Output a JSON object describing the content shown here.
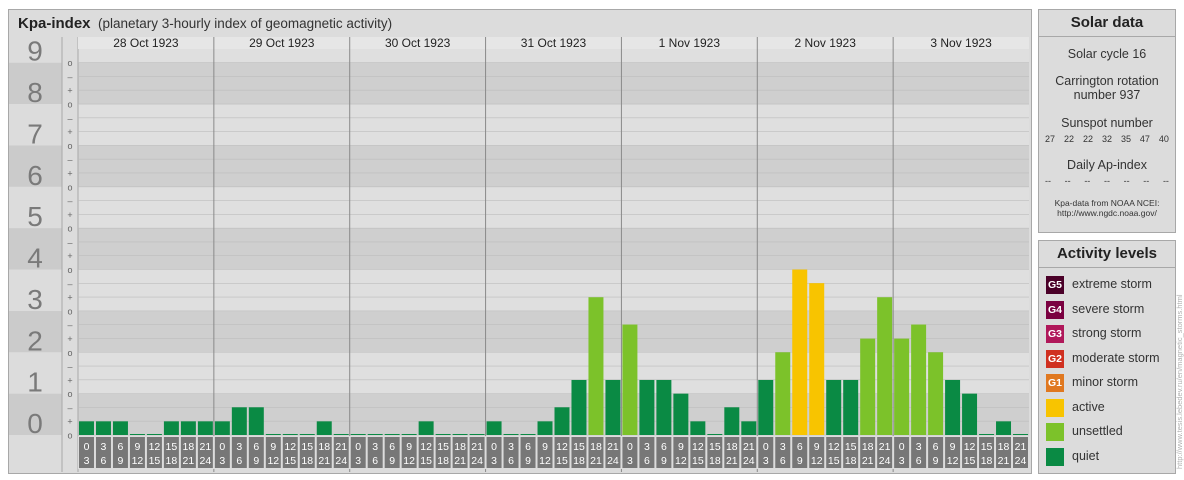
{
  "header": {
    "title": "Kpa-index",
    "subtitle": "(planetary 3-hourly index of geomagnetic activity)"
  },
  "chart_data": {
    "type": "bar",
    "days": [
      "28 Oct 1923",
      "29 Oct 1923",
      "30 Oct 1923",
      "31 Oct 1923",
      "1 Nov 1923",
      "2 Nov 1923",
      "3 Nov 1923"
    ],
    "interval_labels": [
      [
        "0",
        "3"
      ],
      [
        "3",
        "6"
      ],
      [
        "6",
        "9"
      ],
      [
        "9",
        "12"
      ],
      [
        "12",
        "15"
      ],
      [
        "15",
        "18"
      ],
      [
        "18",
        "21"
      ],
      [
        "21",
        "24"
      ]
    ],
    "y_major_labels": [
      "0",
      "1",
      "2",
      "3",
      "4",
      "5",
      "6",
      "7",
      "8",
      "9"
    ],
    "y_minor_labels": [
      "o",
      "+",
      "–",
      "o"
    ],
    "ylim": [
      0,
      9.33
    ],
    "values": [
      [
        0.33,
        0.33,
        0.33,
        0,
        0,
        0.33,
        0.33,
        0.33
      ],
      [
        0.33,
        0.67,
        0.67,
        0,
        0,
        0,
        0.33,
        0
      ],
      [
        0,
        0,
        0,
        0,
        0.33,
        0,
        0,
        0
      ],
      [
        0.33,
        0,
        0,
        0.33,
        0.67,
        1.33,
        3.33,
        1.33
      ],
      [
        2.67,
        1.33,
        1.33,
        1,
        0.33,
        0,
        0.67,
        0.33
      ],
      [
        1.33,
        2,
        4,
        3.67,
        1.33,
        1.33,
        2.33,
        3.33
      ],
      [
        2.33,
        2.67,
        2,
        1.33,
        1,
        0,
        0.33,
        0
      ]
    ],
    "grid": true
  },
  "solar": {
    "title": "Solar data",
    "cycle": "Solar cycle 16",
    "carrington_line1": "Carrington rotation",
    "carrington_line2": "number 937",
    "sunspot_title": "Sunspot number",
    "sunspots": [
      "27",
      "22",
      "22",
      "32",
      "35",
      "47",
      "40"
    ],
    "ap_title": "Daily Ap-index",
    "ap": [
      "--",
      "--",
      "--",
      "--",
      "--",
      "--",
      "--"
    ],
    "source_line1": "Kpa-data from NOAA NCEI:",
    "source_line2": "http://www.ngdc.noaa.gov/"
  },
  "activity": {
    "title": "Activity levels",
    "items": [
      {
        "badge": "G5",
        "label": "extreme storm",
        "color": "#4a0028"
      },
      {
        "badge": "G4",
        "label": "severe storm",
        "color": "#7a0040"
      },
      {
        "badge": "G3",
        "label": "strong storm",
        "color": "#b0185a"
      },
      {
        "badge": "G2",
        "label": "moderate storm",
        "color": "#d03020"
      },
      {
        "badge": "G1",
        "label": "minor storm",
        "color": "#e07820"
      },
      {
        "badge": "",
        "label": "active",
        "color": "#f8c400"
      },
      {
        "badge": "",
        "label": "unsettled",
        "color": "#7cc22a"
      },
      {
        "badge": "",
        "label": "quiet",
        "color": "#0a8a44"
      }
    ]
  },
  "watermark": "http://www.tesis.lebedev.ru/en/magnetic_storms.html"
}
